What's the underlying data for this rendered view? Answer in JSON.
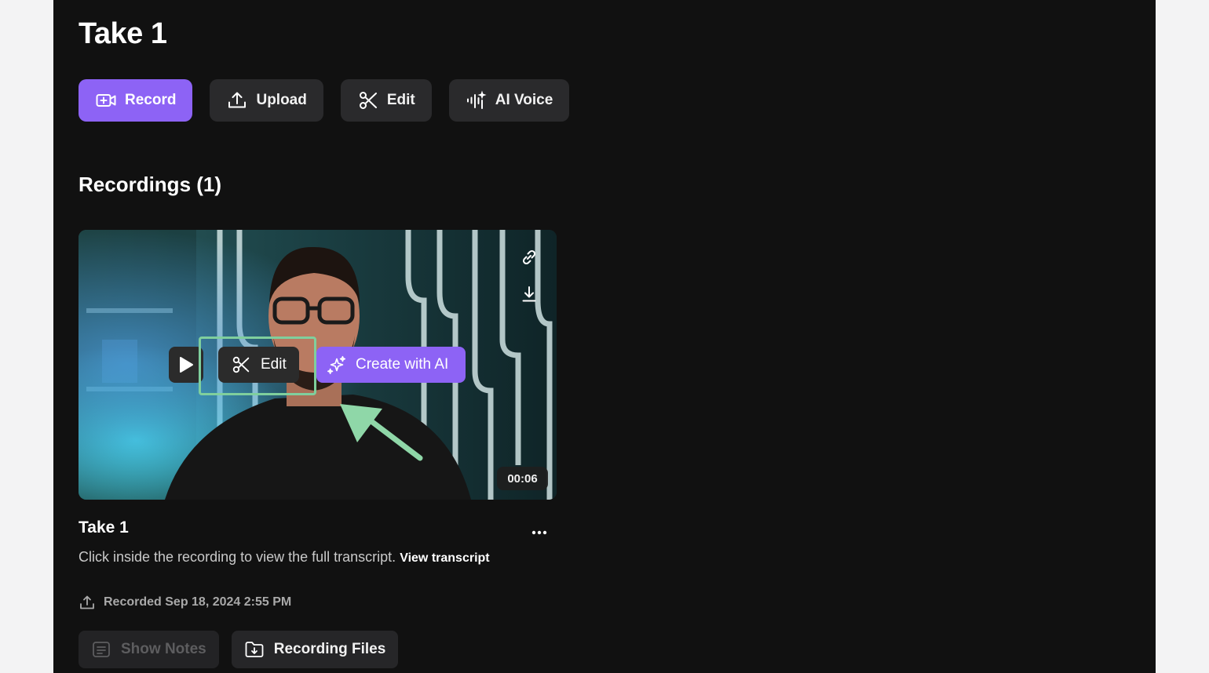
{
  "page": {
    "title": "Take 1"
  },
  "toolbar": {
    "record_label": "Record",
    "upload_label": "Upload",
    "edit_label": "Edit",
    "ai_voice_label": "AI Voice"
  },
  "recordings": {
    "heading": "Recordings (1)",
    "items": [
      {
        "title": "Take 1",
        "duration": "00:06",
        "overlay_edit_label": "Edit",
        "overlay_ai_label": "Create with AI",
        "description": "Click inside the recording to view the full transcript.",
        "view_link": "View transcript",
        "recorded": "Recorded Sep 18, 2024 2:55 PM",
        "show_notes_label": "Show Notes",
        "recording_files_label": "Recording Files"
      }
    ]
  },
  "colors": {
    "accent": "#8d63f5",
    "highlight": "#7fcf9d",
    "panel": "#111111",
    "button": "#2a2a2c"
  },
  "icons": {
    "record": "video-plus-icon",
    "upload": "upload-icon",
    "edit": "scissors-icon",
    "ai_voice": "voice-sparkle-icon",
    "link": "link-icon",
    "download": "download-icon",
    "play": "play-icon",
    "ai": "sparkles-icon",
    "more": "more-horizontal-icon",
    "notes": "notes-icon",
    "files": "folder-download-icon"
  }
}
